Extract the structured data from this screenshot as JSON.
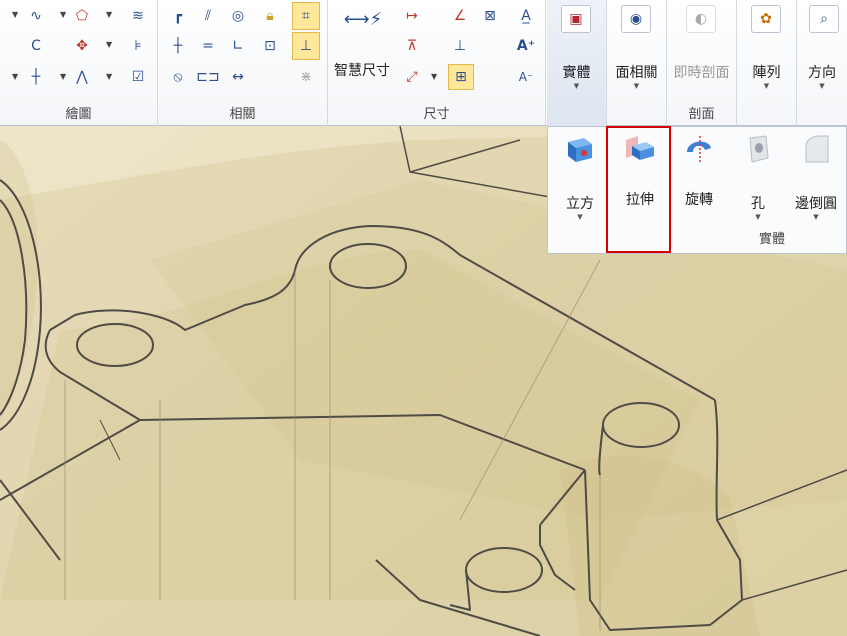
{
  "ribbon": {
    "groups": {
      "sketch": {
        "label": "繪圖"
      },
      "relations": {
        "label": "相關"
      },
      "dimension": {
        "label": "尺寸",
        "smart_dimension_label": "智慧尺寸"
      }
    },
    "big_buttons": [
      {
        "label": "實體",
        "icon": "solids-icon",
        "has_dropdown": true,
        "active": true
      },
      {
        "label": "面相關",
        "icon": "face-related-icon",
        "has_dropdown": true
      },
      {
        "label": "即時剖面",
        "icon": "live-section-icon",
        "disabled": true
      },
      {
        "label": "陣列",
        "icon": "pattern-icon",
        "has_dropdown": true
      },
      {
        "label": "方向",
        "icon": "orient-icon",
        "has_dropdown": true
      }
    ],
    "section_group_label": "剖面"
  },
  "solids_dropdown": {
    "group_label": "實體",
    "items": [
      {
        "label": "立方",
        "icon": "cube-icon",
        "has_dropdown": true
      },
      {
        "label": "拉伸",
        "icon": "extrude-icon",
        "highlighted": true
      },
      {
        "label": "旋轉",
        "icon": "revolve-icon"
      },
      {
        "label": "孔",
        "icon": "hole-icon",
        "has_dropdown": true
      },
      {
        "label": "邊倒圓",
        "icon": "round-icon",
        "has_dropdown": true
      }
    ]
  },
  "colors": {
    "viewport_bg": "#ece3c6",
    "model_fill": "#d9cb95",
    "edge": "#4a4a4a",
    "highlight_border": "#d40000"
  }
}
